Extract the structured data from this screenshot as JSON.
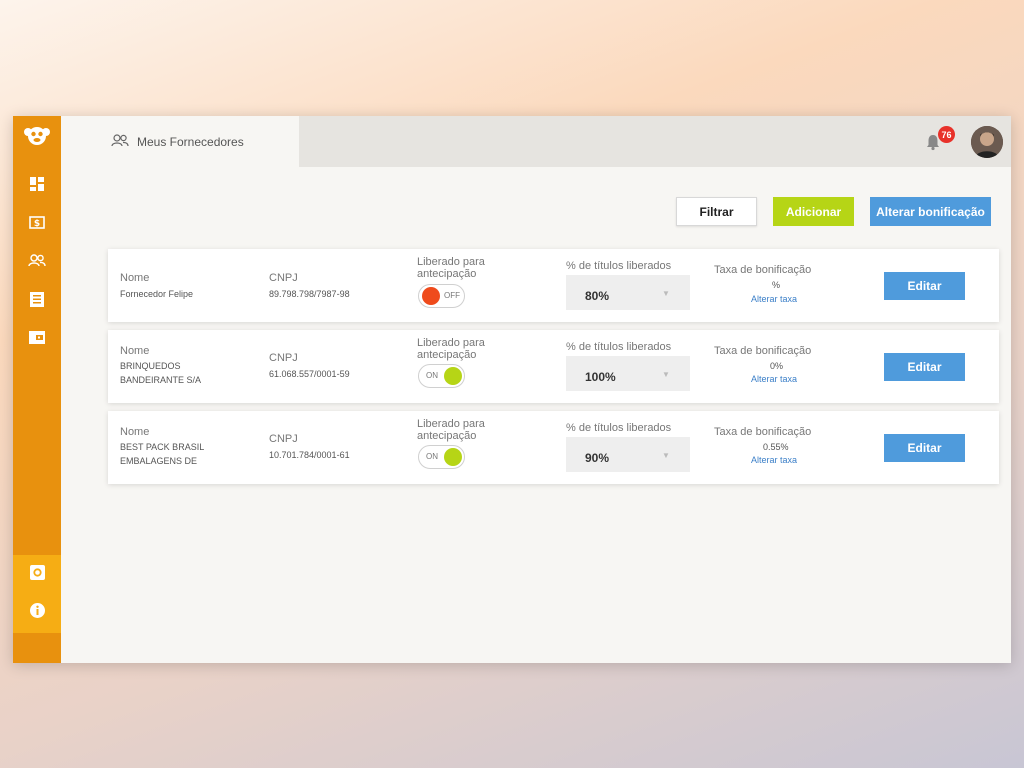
{
  "topbar": {
    "tab_label": "Meus Fornecedores",
    "notification_count": "76"
  },
  "actions": {
    "filter": "Filtrar",
    "add": "Adicionar",
    "change_bonus": "Alterar bonificação"
  },
  "labels": {
    "name": "Nome",
    "cnpj": "CNPJ",
    "released_line1": "Liberado para",
    "released_line2": "antecipação",
    "percent_titles": "% de títulos liberados",
    "bonus_rate": "Taxa de bonificação",
    "change_rate": "Alterar taxa",
    "edit": "Editar"
  },
  "suppliers": [
    {
      "name_line1": "Fornecedor Felipe",
      "name_line2": "",
      "cnpj": "89.798.798/7987-98",
      "toggle": "OFF",
      "percent": "80%",
      "rate": "%"
    },
    {
      "name_line1": "BRINQUEDOS",
      "name_line2": "BANDEIRANTE S/A",
      "cnpj": "61.068.557/0001-59",
      "toggle": "ON",
      "percent": "100%",
      "rate": "0%"
    },
    {
      "name_line1": "BEST PACK BRASIL",
      "name_line2": "EMBALAGENS DE",
      "cnpj": "10.701.784/0001-61",
      "toggle": "ON",
      "percent": "90%",
      "rate": "0.55%"
    }
  ],
  "colors": {
    "sidebar": "#e8910e",
    "toggle_on": "#b6d516",
    "toggle_off": "#ef4b1c",
    "primary": "#4f9bdc"
  }
}
